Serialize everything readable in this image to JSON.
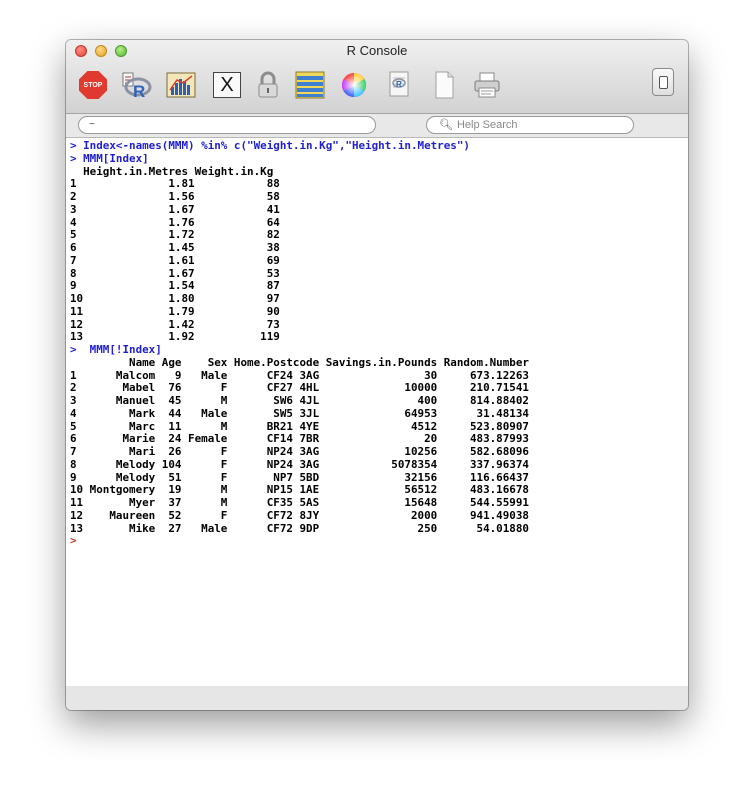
{
  "window": {
    "title": "R Console"
  },
  "toolbar": {
    "stop_label": "STOP",
    "icons": [
      "stop-icon",
      "r-source-icon",
      "chart-icon",
      "x11-icon",
      "lock-icon",
      "list-icon",
      "color-wheel-icon",
      "r-document-icon",
      "new-file-icon",
      "print-icon",
      "toggle-drawer-icon"
    ]
  },
  "fields": {
    "cwd_value": "~",
    "help_placeholder": "Help Search"
  },
  "console": {
    "lines": [
      {
        "kind": "cmd",
        "text": "> Index<-names(MMM) %in% c(\"Weight.in.Kg\",\"Height.in.Metres\")"
      },
      {
        "kind": "cmd",
        "text": "> MMM[Index]"
      },
      {
        "kind": "out",
        "text": "  Height.in.Metres Weight.in.Kg"
      },
      {
        "kind": "out",
        "text": "1              1.81           88"
      },
      {
        "kind": "out",
        "text": "2              1.56           58"
      },
      {
        "kind": "out",
        "text": "3              1.67           41"
      },
      {
        "kind": "out",
        "text": "4              1.76           64"
      },
      {
        "kind": "out",
        "text": "5              1.72           82"
      },
      {
        "kind": "out",
        "text": "6              1.45           38"
      },
      {
        "kind": "out",
        "text": "7              1.61           69"
      },
      {
        "kind": "out",
        "text": "8              1.67           53"
      },
      {
        "kind": "out",
        "text": "9              1.54           87"
      },
      {
        "kind": "out",
        "text": "10             1.80           97"
      },
      {
        "kind": "out",
        "text": "11             1.79           90"
      },
      {
        "kind": "out",
        "text": "12             1.42           73"
      },
      {
        "kind": "out",
        "text": "13             1.92          119"
      },
      {
        "kind": "cmd",
        "text": ">  MMM[!Index]"
      },
      {
        "kind": "out",
        "text": "         Name Age    Sex Home.Postcode Savings.in.Pounds Random.Number"
      },
      {
        "kind": "out",
        "text": "1      Malcom   9   Male      CF24 3AG                30     673.12263"
      },
      {
        "kind": "out",
        "text": "2       Mabel  76      F      CF27 4HL             10000     210.71541"
      },
      {
        "kind": "out",
        "text": "3      Manuel  45      M       SW6 4JL               400     814.88402"
      },
      {
        "kind": "out",
        "text": "4        Mark  44   Male       SW5 3JL             64953      31.48134"
      },
      {
        "kind": "out",
        "text": "5        Marc  11      M      BR21 4YE              4512     523.80907"
      },
      {
        "kind": "out",
        "text": "6       Marie  24 Female      CF14 7BR                20     483.87993"
      },
      {
        "kind": "out",
        "text": "7        Mari  26      F      NP24 3AG             10256     582.68096"
      },
      {
        "kind": "out",
        "text": "8      Melody 104      F      NP24 3AG           5078354     337.96374"
      },
      {
        "kind": "out",
        "text": "9      Melody  51      F       NP7 5BD             32156     116.66437"
      },
      {
        "kind": "out",
        "text": "10 Montgomery  19      M      NP15 1AE             56512     483.16678"
      },
      {
        "kind": "out",
        "text": "11       Myer  37      M      CF35 5AS             15648     544.55991"
      },
      {
        "kind": "out",
        "text": "12    Maureen  52      F      CF72 8JY              2000     941.49038"
      },
      {
        "kind": "out",
        "text": "13       Mike  27   Male      CF72 9DP               250      54.01880"
      },
      {
        "kind": "prompt",
        "text": ">"
      }
    ]
  },
  "colors": {
    "command_text": "#1f1fd0",
    "output_text": "#000000",
    "prompt_symbol": "#c0392b"
  }
}
